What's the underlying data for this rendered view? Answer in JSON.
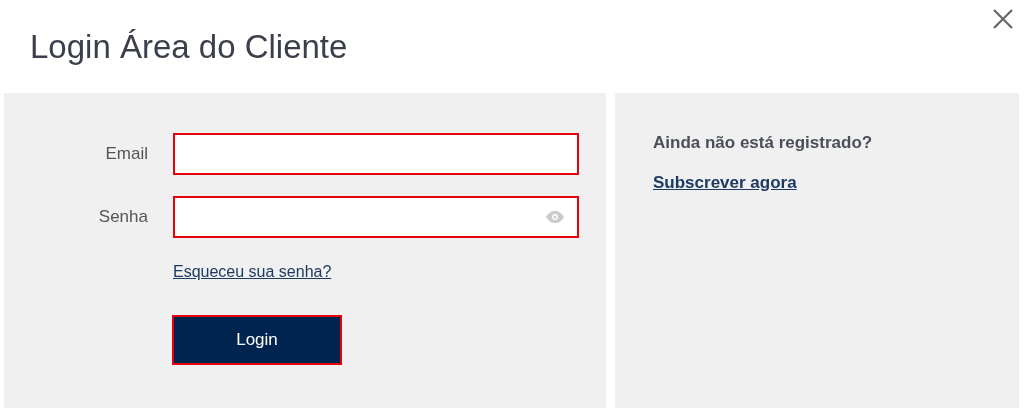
{
  "dialog": {
    "title": "Login Área do Cliente"
  },
  "login_form": {
    "fields": [
      {
        "label": "Email",
        "kind": "text",
        "error": true
      },
      {
        "label": "Senha",
        "kind": "password",
        "error": true
      }
    ],
    "forgot_link": "Esqueceu sua senha?",
    "button": {
      "label": "Login",
      "error": true
    }
  },
  "register": {
    "question": "Ainda não está registrado?",
    "link": "Subscrever agora"
  }
}
